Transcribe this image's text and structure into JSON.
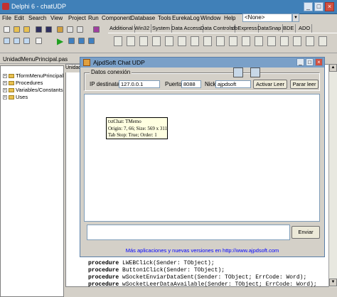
{
  "ide": {
    "title": "Delphi 6 - chatUDP",
    "menu": [
      "File",
      "Edit",
      "Search",
      "View",
      "Project",
      "Run",
      "Component",
      "Database",
      "Tools",
      "EurekaLog",
      "Window",
      "Help"
    ],
    "combo_value": "<None>",
    "palette_tabs": [
      "Additional",
      "Win32",
      "System",
      "Data Access",
      "Data Controls",
      "dbExpress",
      "DataSnap",
      "BDE",
      "ADO"
    ]
  },
  "tree": {
    "tab_label": "UnidadMenuPrincipal.pas",
    "items": [
      "TformMenuPrincipal",
      "Procedures",
      "Variables/Constants",
      "Uses"
    ]
  },
  "editor": {
    "side_tab": "Unidad",
    "bottom_lines": [
      "procedure LWEBClick(Sender: TObject);",
      "procedure Button1Click(Sender: TObject);",
      "procedure wSocketEnviarDataSent(Sender: TObject; ErrCode: Word);",
      "procedure wSocketLeerDataAvailable(Sender: TObject; ErrCode: Word);"
    ]
  },
  "dialog": {
    "title": "AjpdSoft Chat UDP",
    "group_label": "Datos conexión",
    "ip_label": "IP destinatario",
    "ip_value": "127.0.0.1",
    "port_label": "Puerto",
    "port_value": "8088",
    "nick_label": "Nick",
    "nick_value": "ajpdsoft",
    "activate_button": "Activar Leer",
    "stop_button": "Parar leer",
    "tooltip_lines": [
      "txtChat: TMemo",
      "Origin: 7, 66; Size: 569 x 311",
      "Tab Stop: True; Order: 1"
    ],
    "send_button": "Enviar",
    "link_text": "Más aplicaciones y nuevas versiones en http://www.ajpdsoft.com"
  }
}
